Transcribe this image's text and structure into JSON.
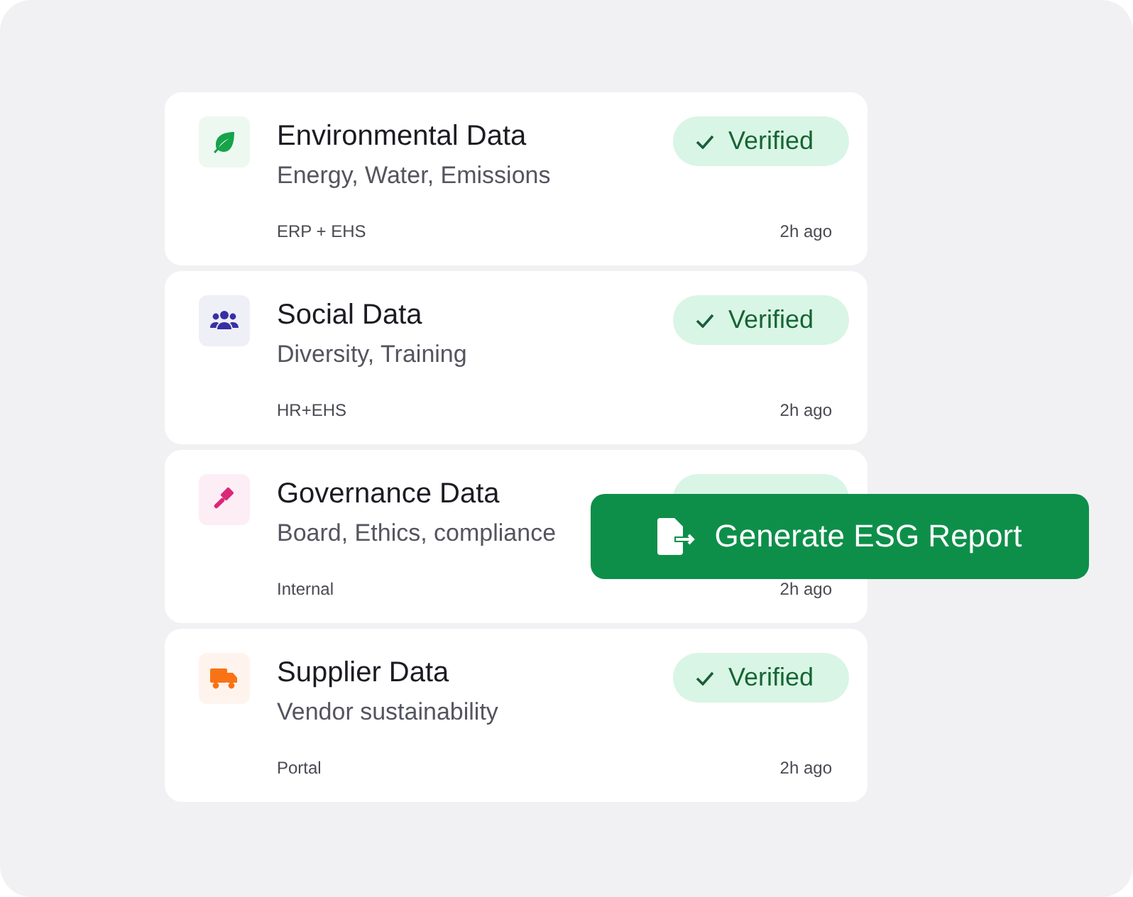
{
  "sources": [
    {
      "kind": "leaf",
      "color": "#16a34a",
      "title": "Environmental Data",
      "subtitle": "Energy, Water, Emissions",
      "system": "ERP + EHS",
      "time": "2h ago",
      "status": {
        "verified": true,
        "label": "Verified"
      }
    },
    {
      "kind": "people",
      "color": "#3730a3",
      "title": "Social Data",
      "subtitle": "Diversity, Training",
      "system": "HR+EHS",
      "time": "2h ago",
      "status": {
        "verified": true,
        "label": "Verified"
      }
    },
    {
      "kind": "gavel",
      "color": "#db2777",
      "title": "Governance Data",
      "subtitle": "Board, Ethics, compliance",
      "system": "Internal",
      "time": "2h ago",
      "status": {
        "verified": true
      }
    },
    {
      "kind": "truck",
      "color": "#f97316",
      "title": "Supplier Data",
      "subtitle": "Vendor sustainability",
      "system": "Portal",
      "time": "2h ago",
      "status": {
        "verified": true,
        "label": "Verified"
      }
    }
  ],
  "action": {
    "label": "Generate ESG Report"
  }
}
